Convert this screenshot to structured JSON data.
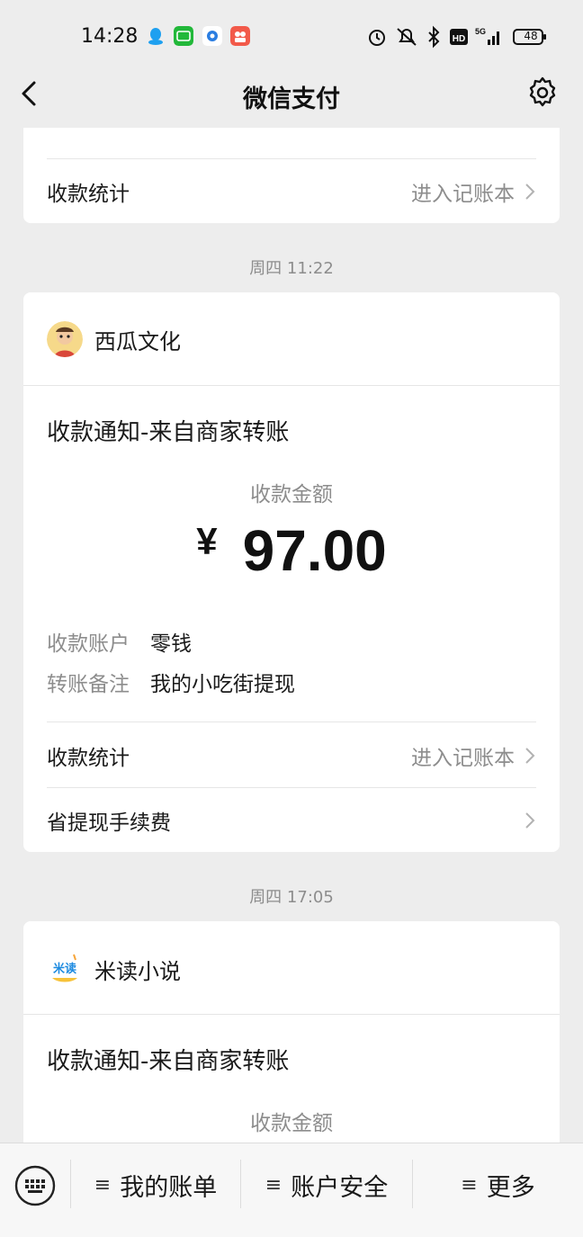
{
  "status": {
    "time": "14:28",
    "battery": "48"
  },
  "nav": {
    "title": "微信支付"
  },
  "top_card": {
    "stats_label": "收款统计",
    "stats_link": "进入记账本"
  },
  "messages": [
    {
      "time": "周四 11:22",
      "merchant": "西瓜文化",
      "title": "收款通知-来自商家转账",
      "amount_label": "收款金额",
      "currency": "¥",
      "amount": "97.00",
      "details": [
        {
          "key": "收款账户",
          "value": "零钱"
        },
        {
          "key": "转账备注",
          "value": "我的小吃街提现"
        }
      ],
      "stats_label": "收款统计",
      "stats_link": "进入记账本",
      "fee_label": "省提现手续费"
    },
    {
      "time": "周四 17:05",
      "merchant": "米读小说",
      "title": "收款通知-来自商家转账",
      "amount_label": "收款金额"
    }
  ],
  "bottom_menu": {
    "bars_glyph": "≡",
    "items": [
      "我的账单",
      "账户安全",
      "更多"
    ]
  },
  "colors": {
    "background": "#ededed",
    "card": "#ffffff",
    "secondary_text": "#8d8d8d"
  }
}
